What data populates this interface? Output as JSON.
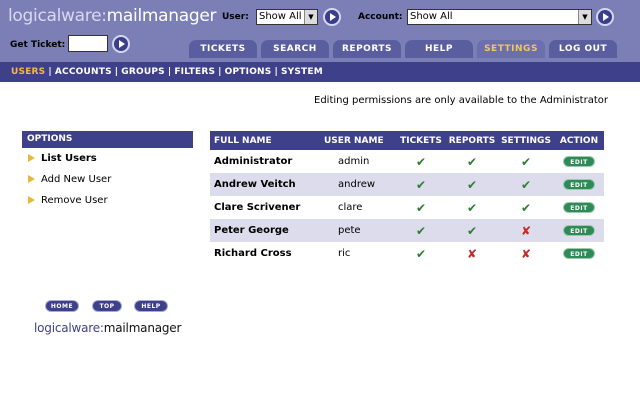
{
  "header": {
    "logo_part1": "logicalware:",
    "logo_part2": "mailmanager",
    "user_label": "User:",
    "user_value": "Show All",
    "account_label": "Account:",
    "account_value": "Show All",
    "ticket_label": "Get Ticket:"
  },
  "tabs": [
    {
      "label": "TICKETS"
    },
    {
      "label": "SEARCH"
    },
    {
      "label": "REPORTS"
    },
    {
      "label": "HELP"
    },
    {
      "label": "SETTINGS",
      "active": true
    },
    {
      "label": "LOG OUT"
    }
  ],
  "subnav": [
    "USERS",
    "ACCOUNTS",
    "GROUPS",
    "FILTERS",
    "OPTIONS",
    "SYSTEM"
  ],
  "admin_note": "Editing permissions are only available to the Administrator",
  "options": {
    "title": "OPTIONS",
    "items": [
      "List Users",
      "Add New User",
      "Remove User"
    ]
  },
  "table": {
    "headers": [
      "FULL NAME",
      "USER NAME",
      "TICKETS",
      "REPORTS",
      "SETTINGS",
      "ACTION"
    ],
    "rows": [
      {
        "full_name": "Administrator",
        "user_name": "admin",
        "tickets": true,
        "reports": true,
        "settings": true
      },
      {
        "full_name": "Andrew Veitch",
        "user_name": "andrew",
        "tickets": true,
        "reports": true,
        "settings": true
      },
      {
        "full_name": "Clare Scrivener",
        "user_name": "clare",
        "tickets": true,
        "reports": true,
        "settings": true
      },
      {
        "full_name": "Peter George",
        "user_name": "pete",
        "tickets": true,
        "reports": true,
        "settings": false
      },
      {
        "full_name": "Richard Cross",
        "user_name": "ric",
        "tickets": true,
        "reports": false,
        "settings": false
      }
    ],
    "edit_label": "EDIT"
  },
  "footer": {
    "home": "HOME",
    "top": "TOP",
    "help": "HELP",
    "logo_part1": "logicalware:",
    "logo_part2": "mailmanager"
  },
  "colors": {
    "header": "#7b7fb6",
    "nav": "#3e418a",
    "active_tab_text": "#f3c567",
    "row_alt": "#dcdcec",
    "check": "#2e7d32",
    "cross": "#c62828"
  },
  "icons": {
    "check": "check-icon",
    "cross": "cross-icon",
    "go": "play-arrow-icon",
    "bullet": "triangle-bullet-icon"
  }
}
